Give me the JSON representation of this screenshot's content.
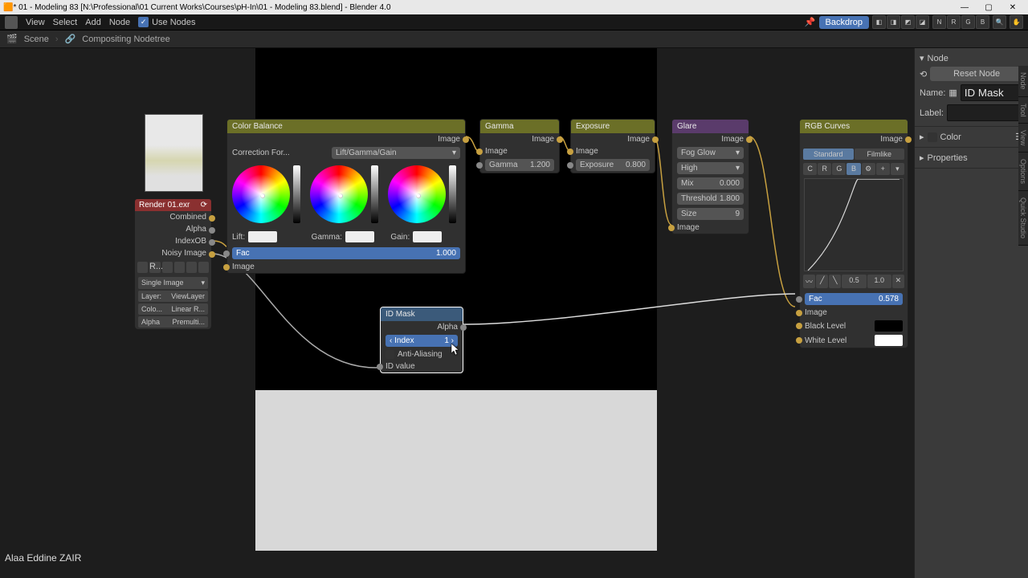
{
  "titlebar": {
    "title": "* 01 - Modeling 83 [N:\\Professional\\01 Current Works\\Courses\\pH-In\\01 - Modeling 83.blend] - Blender 4.0",
    "icon": "blender-icon",
    "min": "—",
    "max": "▢",
    "close": "✕"
  },
  "menubar": {
    "items": [
      "View",
      "Select",
      "Add",
      "Node"
    ],
    "use_nodes_label": "Use Nodes",
    "use_nodes_check": "✓",
    "backdrop": "Backdrop",
    "tool_letters": [
      "N",
      "R",
      "G",
      "B"
    ]
  },
  "breadcrumb": {
    "scene": "Scene",
    "tree": "Compositing Nodetree"
  },
  "sidepanel": {
    "node_header": "Node",
    "reset": "Reset Node",
    "name_lbl": "Name:",
    "name_val": "ID Mask",
    "label_lbl": "Label:",
    "label_val": "",
    "color_lbl": "Color",
    "props_lbl": "Properties",
    "vtabs": [
      "Node",
      "Tool",
      "View",
      "Options",
      "Quick Studio"
    ]
  },
  "render_node": {
    "title": "Render 01.exr",
    "outputs": [
      "Combined",
      "Alpha",
      "IndexOB",
      "Noisy Image"
    ],
    "mode": "Single Image",
    "layer_lbl": "Layer:",
    "layer_val": "ViewLayer",
    "colo_lbl": "Colo...",
    "colo_val": "Linear R...",
    "alpha_lbl": "Alpha",
    "alpha_val": "Premulti...",
    "file_short": "R..."
  },
  "color_balance": {
    "title": "Color Balance",
    "out": "Image",
    "correction_lbl": "Correction For...",
    "correction_val": "Lift/Gamma/Gain",
    "lift": "Lift:",
    "gamma": "Gamma:",
    "gain": "Gain:",
    "fac_lbl": "Fac",
    "fac_val": "1.000",
    "in_image": "Image"
  },
  "gamma_node": {
    "title": "Gamma",
    "out": "Image",
    "in_image": "Image",
    "gamma_lbl": "Gamma",
    "gamma_val": "1.200"
  },
  "exposure_node": {
    "title": "Exposure",
    "out": "Image",
    "in_image": "Image",
    "exp_lbl": "Exposure",
    "exp_val": "0.800"
  },
  "glare_node": {
    "title": "Glare",
    "out": "Image",
    "type": "Fog Glow",
    "quality": "High",
    "mix_lbl": "Mix",
    "mix_val": "0.000",
    "thresh_lbl": "Threshold",
    "thresh_val": "1.800",
    "size_lbl": "Size",
    "size_val": "9",
    "in_image": "Image"
  },
  "idmask_node": {
    "title": "ID Mask",
    "out": "Alpha",
    "index_lbl": "Index",
    "index_val": "1",
    "aa": "Anti-Aliasing",
    "in": "ID value"
  },
  "rgbcurves": {
    "title": "RGB Curves",
    "out": "Image",
    "standard": "Standard",
    "filmlike": "Filmlike",
    "channels": [
      "C",
      "R",
      "G",
      "B"
    ],
    "x_val": "0.5",
    "y_val": "1.0",
    "fac_lbl": "Fac",
    "fac_val": "0.578",
    "in_image": "Image",
    "black": "Black Level",
    "white": "White Level"
  },
  "author": "Alaa Eddine ZAIR"
}
